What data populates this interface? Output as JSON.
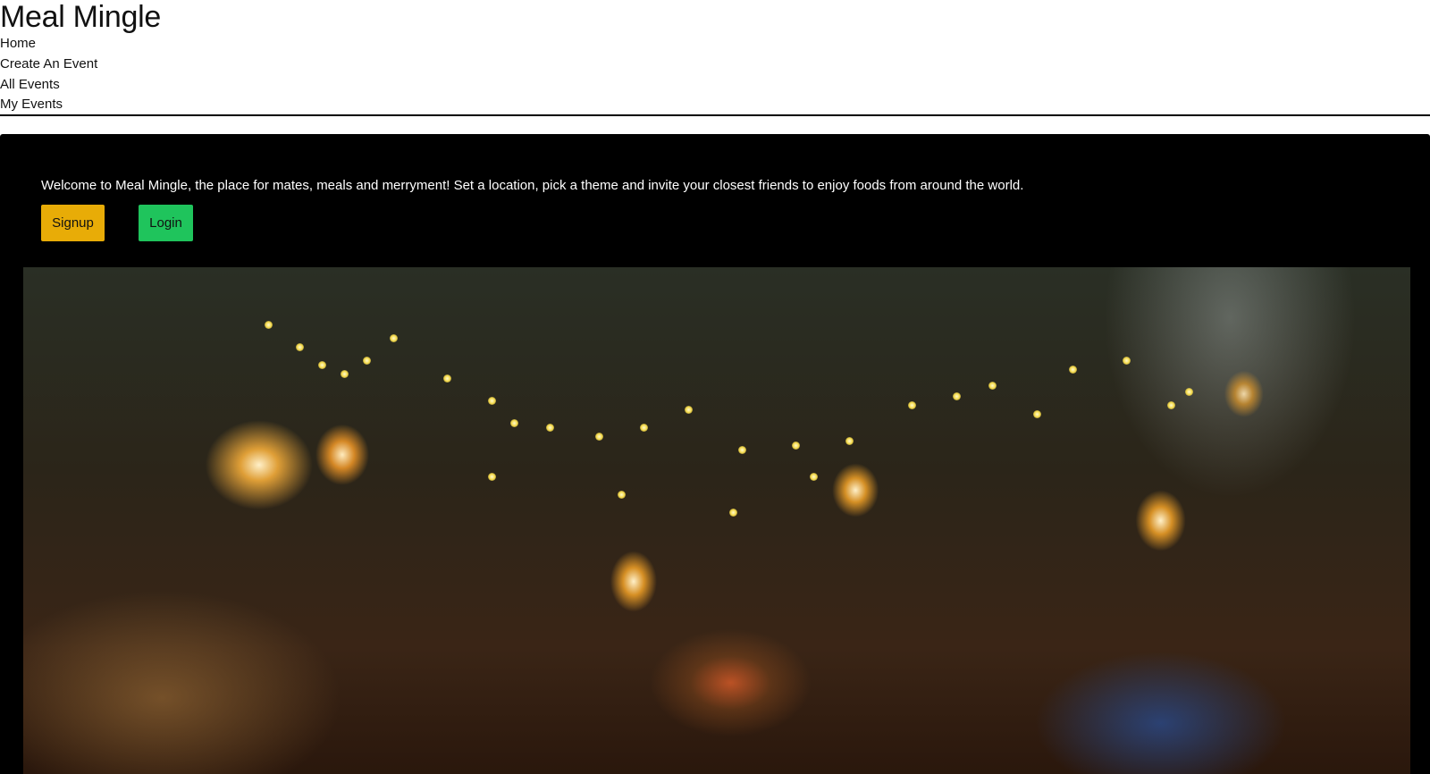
{
  "header": {
    "title": "Meal Mingle",
    "nav": [
      {
        "label": "Home"
      },
      {
        "label": "Create An Event"
      },
      {
        "label": "All Events"
      },
      {
        "label": "My Events"
      }
    ]
  },
  "hero": {
    "welcome_text": "Welcome to Meal Mingle, the place for mates, meals and merryment! Set a location, pick a theme and invite your closest friends to enjoy foods from around the world.",
    "signup_label": "Signup",
    "login_label": "Login",
    "signup_color": "#e8ac07",
    "login_color": "#1fc45c"
  }
}
